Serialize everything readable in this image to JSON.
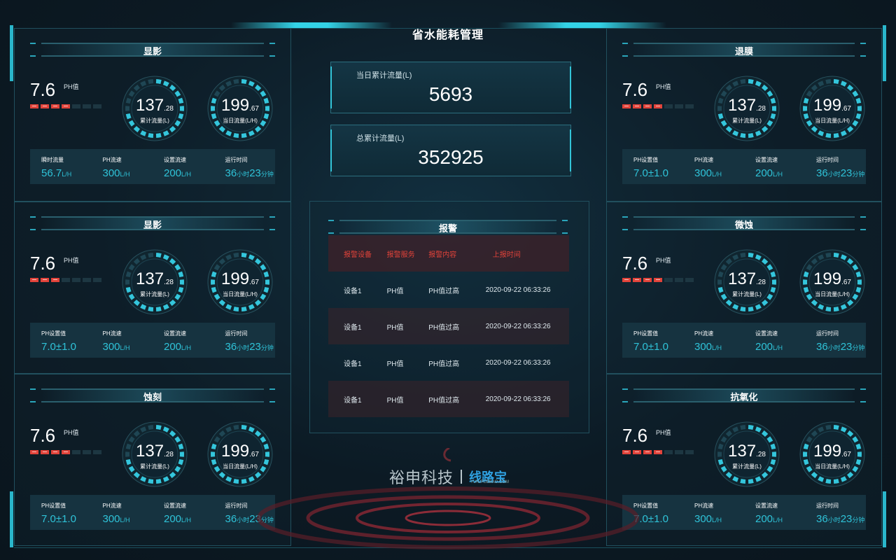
{
  "page_title": "省水能耗管理",
  "units": {
    "flow": "L/H",
    "hour": "小时",
    "minute": "分钟"
  },
  "gauges_common": {
    "total_label": "累计流量(L)",
    "today_label": "当日流量(L/H)"
  },
  "panels": [
    {
      "title": "显影",
      "ph": "7.6",
      "ph_label": "PH值",
      "ph_bars_on": 4,
      "ph_bars_total": 7,
      "g1_int": "137",
      "g1_dec": ".28",
      "g2_int": "199",
      "g2_dec": ".67",
      "stats": [
        {
          "label": "瞬时流量",
          "value": "56.7",
          "unit": "L/H"
        },
        {
          "label": "PH流速",
          "value": "300",
          "unit": "L/H"
        },
        {
          "label": "设置流速",
          "value": "200",
          "unit": "L/H"
        },
        {
          "label": "运行时间",
          "h": "36",
          "m": "23"
        }
      ]
    },
    {
      "title": "显影",
      "ph": "7.6",
      "ph_label": "PH值",
      "ph_bars_on": 3,
      "ph_bars_total": 7,
      "g1_int": "137",
      "g1_dec": ".28",
      "g2_int": "199",
      "g2_dec": ".67",
      "stats": [
        {
          "label": "PH设置值",
          "value": "7.0±1.0",
          "unit": ""
        },
        {
          "label": "PH流速",
          "value": "300",
          "unit": "L/H"
        },
        {
          "label": "设置流速",
          "value": "200",
          "unit": "L/H"
        },
        {
          "label": "运行时间",
          "h": "36",
          "m": "23"
        }
      ]
    },
    {
      "title": "蚀刻",
      "ph": "7.6",
      "ph_label": "PH值",
      "ph_bars_on": 4,
      "ph_bars_total": 7,
      "g1_int": "137",
      "g1_dec": ".28",
      "g2_int": "199",
      "g2_dec": ".67",
      "stats": [
        {
          "label": "PH设置值",
          "value": "7.0±1.0",
          "unit": ""
        },
        {
          "label": "PH流速",
          "value": "300",
          "unit": "L/H"
        },
        {
          "label": "设置流速",
          "value": "200",
          "unit": "L/H"
        },
        {
          "label": "运行时间",
          "h": "36",
          "m": "23"
        }
      ]
    },
    {
      "title": "退膜",
      "ph": "7.6",
      "ph_label": "PH值",
      "ph_bars_on": 4,
      "ph_bars_total": 7,
      "g1_int": "137",
      "g1_dec": ".28",
      "g2_int": "199",
      "g2_dec": ".67",
      "stats": [
        {
          "label": "PH设置值",
          "value": "7.0±1.0",
          "unit": ""
        },
        {
          "label": "PH流速",
          "value": "300",
          "unit": "L/H"
        },
        {
          "label": "设置流速",
          "value": "200",
          "unit": "L/H"
        },
        {
          "label": "运行时间",
          "h": "36",
          "m": "23"
        }
      ]
    },
    {
      "title": "微蚀",
      "ph": "7.6",
      "ph_label": "PH值",
      "ph_bars_on": 4,
      "ph_bars_total": 7,
      "g1_int": "137",
      "g1_dec": ".28",
      "g2_int": "199",
      "g2_dec": ".67",
      "stats": [
        {
          "label": "PH设置值",
          "value": "7.0±1.0",
          "unit": ""
        },
        {
          "label": "PH流速",
          "value": "300",
          "unit": "L/H"
        },
        {
          "label": "设置流速",
          "value": "200",
          "unit": "L/H"
        },
        {
          "label": "运行时间",
          "h": "36",
          "m": "23"
        }
      ]
    },
    {
      "title": "抗氧化",
      "ph": "7.6",
      "ph_label": "PH值",
      "ph_bars_on": 4,
      "ph_bars_total": 7,
      "g1_int": "137",
      "g1_dec": ".28",
      "g2_int": "199",
      "g2_dec": ".67",
      "stats": [
        {
          "label": "PH设置值",
          "value": "7.0±1.0",
          "unit": ""
        },
        {
          "label": "PH流速",
          "value": "300",
          "unit": "L/H"
        },
        {
          "label": "设置流速",
          "value": "200",
          "unit": "L/H"
        },
        {
          "label": "运行时间",
          "h": "36",
          "m": "23"
        }
      ]
    }
  ],
  "kpi": {
    "today_label": "当日累计流量(L)",
    "today_value": "5693",
    "total_label": "总累计流量(L)",
    "total_value": "352925"
  },
  "alarm": {
    "title": "报警",
    "headers": [
      "报警设备",
      "报警服务",
      "报警内容",
      "上报时间"
    ],
    "rows": [
      [
        "设备1",
        "PH值",
        "PH值过高",
        "2020-09-22 06:33:26"
      ],
      [
        "设备1",
        "PH值",
        "PH值过高",
        "2020-09-22 06:33:26"
      ],
      [
        "设备1",
        "PH值",
        "PH值过高",
        "2020-09-22 06:33:26"
      ],
      [
        "设备1",
        "PH值",
        "PH值过高",
        "2020-09-22 06:33:26"
      ]
    ]
  },
  "logo": {
    "brand": "裕申科技",
    "sub_brand": "线路宝",
    "sub_url": "YUN.PCBBAO.COM"
  },
  "colors": {
    "accent": "#33d2e6",
    "value_cyan": "#2fc3d8",
    "alarm_red": "#e2433a",
    "background": "#0d1c26"
  }
}
